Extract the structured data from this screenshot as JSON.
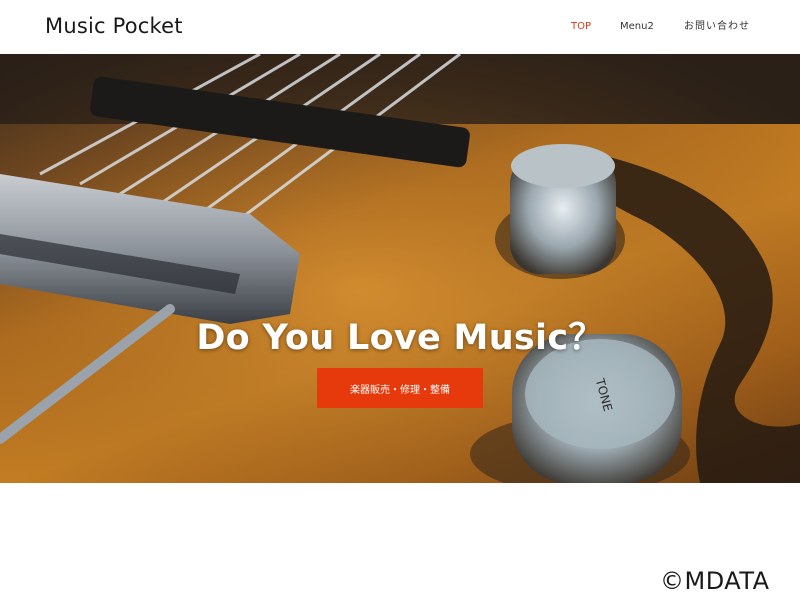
{
  "header": {
    "logo": "Music Pocket",
    "nav": [
      {
        "label": "TOP",
        "active": true
      },
      {
        "label": "Menu2",
        "active": false
      },
      {
        "label": "お問い合わせ",
        "active": false
      }
    ],
    "active_color": "#e03a14"
  },
  "hero": {
    "title": "Do You Love Music？",
    "cta_label": "楽器販売・修理・整備",
    "cta_color": "#e73a0c",
    "image_subject": "guitar-closeup",
    "knob_text": "TONE"
  },
  "watermark": "©MDATA"
}
